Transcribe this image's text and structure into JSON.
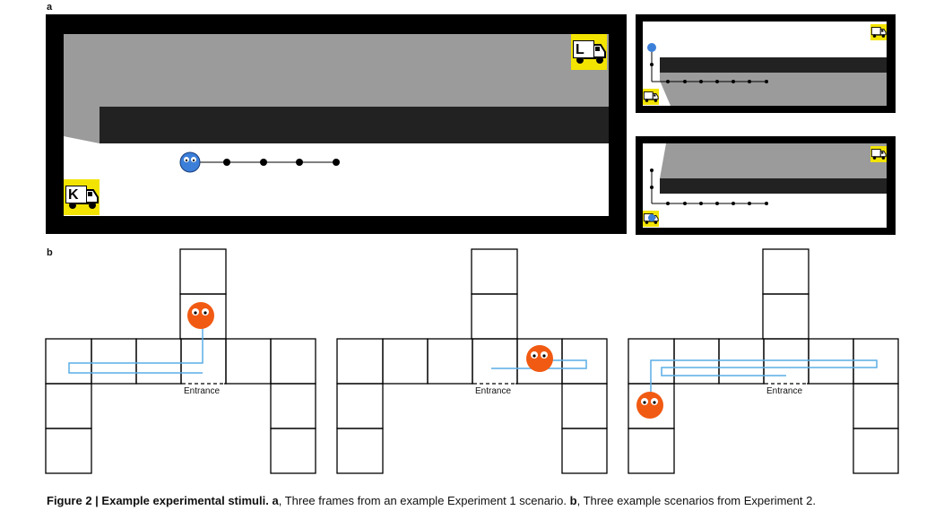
{
  "panels": {
    "a_label": "a",
    "b_label": "b"
  },
  "experiment1": {
    "truck_k_letter": "K",
    "truck_l_letter": "L"
  },
  "experiment2": {
    "entrance_label": "Entrance"
  },
  "caption": {
    "figure_label": "Figure 2 | Example experimental stimuli.",
    "part_a_label": "a",
    "part_a_text": ", Three frames from an example Experiment 1 scenario.",
    "part_b_label": "b",
    "part_b_text": ", Three example scenarios from Experiment 2."
  },
  "colors": {
    "frame": "#000000",
    "shadow": "#9b9b9b",
    "wall": "#222222",
    "truck_bg": "#f2e400",
    "agent_blue": "#3b7fd9",
    "agent_orange": "#f15a12",
    "path_blue": "#5aaee6"
  },
  "icons": [
    "truck-icon",
    "agent-icon"
  ]
}
